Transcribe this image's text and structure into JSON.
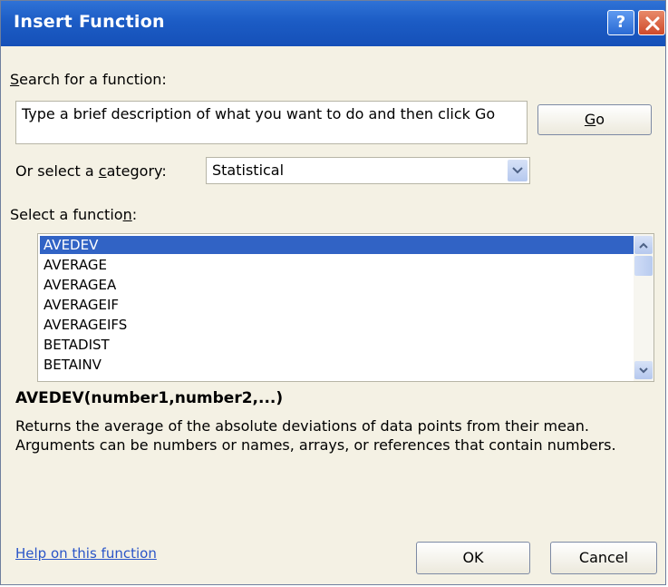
{
  "window": {
    "title": "Insert Function",
    "help_glyph": "?"
  },
  "search": {
    "label_prefix": "S",
    "label_rest": "earch for a function:",
    "value": "Type a brief description of what you want to do and then click Go",
    "go_button_prefix": "G",
    "go_button_rest": "o"
  },
  "category": {
    "label_before": "Or select a ",
    "label_underline": "c",
    "label_after": "ategory:",
    "selected": "Statistical"
  },
  "function_list": {
    "label_before": "Select a functio",
    "label_underline": "n",
    "label_after": ":",
    "items": [
      "AVEDEV",
      "AVERAGE",
      "AVERAGEA",
      "AVERAGEIF",
      "AVERAGEIFS",
      "BETADIST",
      "BETAINV"
    ],
    "selected_index": 0
  },
  "selected_function": {
    "signature": "AVEDEV(number1,number2,...)",
    "description": "Returns the average of the absolute deviations of data points from their mean. Arguments can be numbers or names, arrays, or references that contain numbers."
  },
  "footer": {
    "help_link": "Help on this function",
    "ok_button": "OK",
    "cancel_button": "Cancel"
  },
  "colors": {
    "titlebar": "#1c5cc5",
    "selection": "#3163c5",
    "link": "#2a55c8",
    "dialog_bg": "#f4f1e4"
  }
}
